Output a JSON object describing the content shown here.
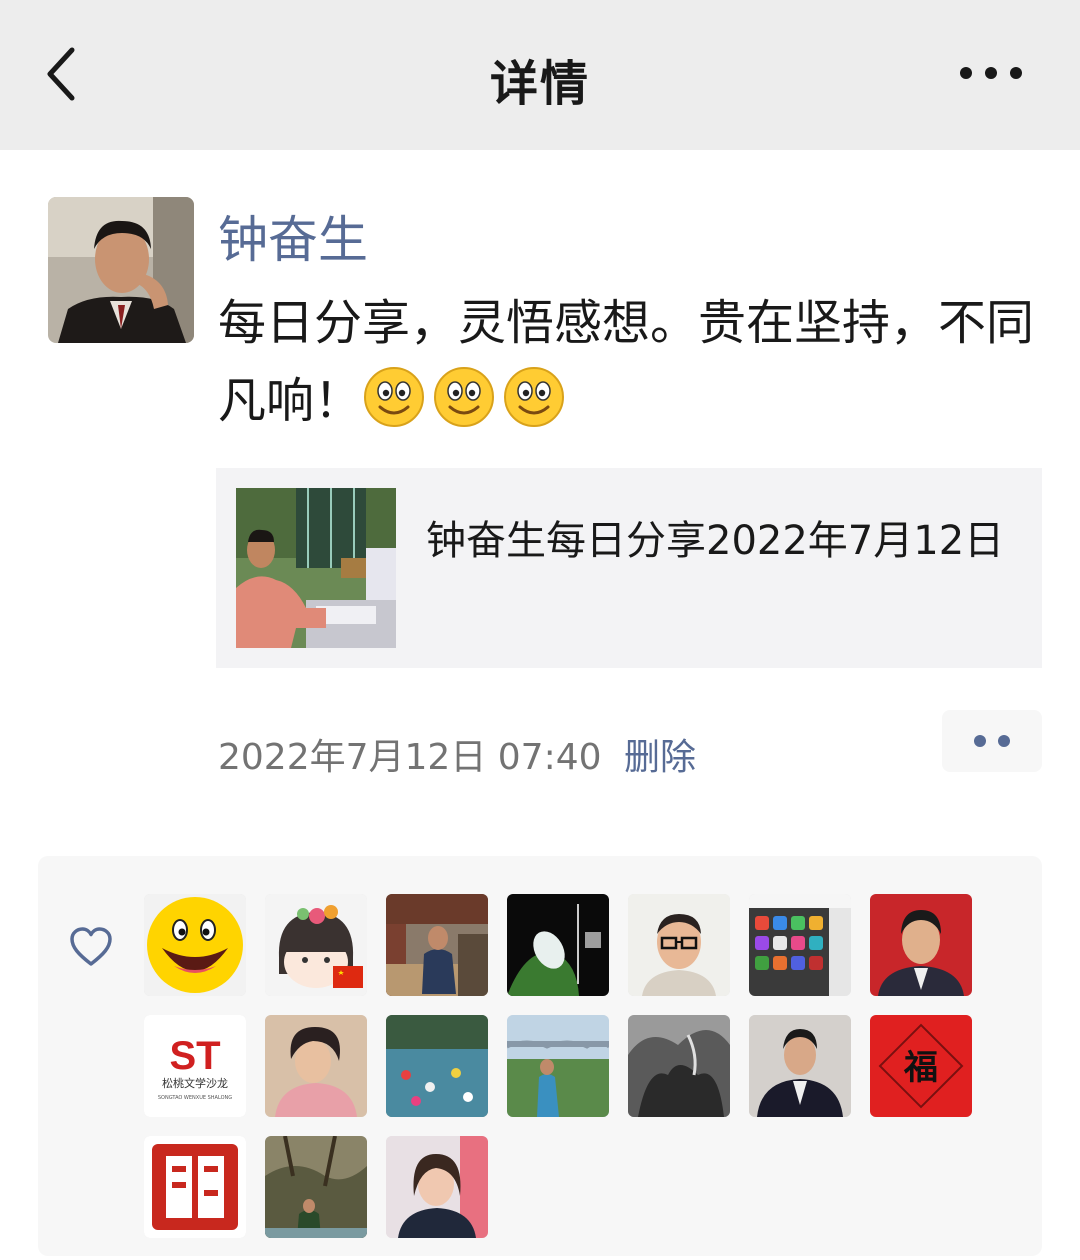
{
  "header": {
    "title": "详情"
  },
  "post": {
    "author": "钟奋生",
    "text": "每日分享，灵悟感想。贵在坚持，不同凡响！",
    "emoji_count": 3,
    "link": {
      "title": "钟奋生每日分享2022年7月12日"
    },
    "timestamp": "2022年7月12日 07:40",
    "delete_label": "删除"
  },
  "likes": {
    "thumb_text": {
      "st_logo": "ST",
      "st_name": "松桃文学沙龙",
      "st_sub": "SONGTAO WENXUE SHALONG",
      "fu": "福"
    }
  },
  "colors": {
    "topbar_bg": "#ededed",
    "link_blue": "#576b95",
    "panel_bg": "#f7f7f7"
  }
}
